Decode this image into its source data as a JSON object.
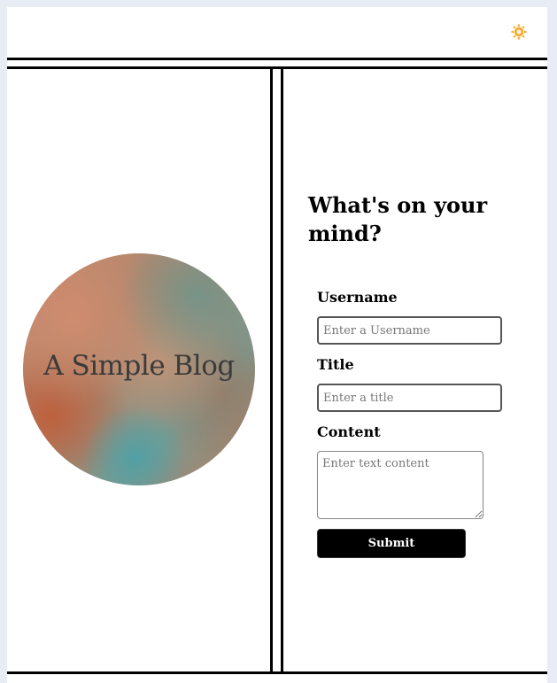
{
  "header": {
    "theme_toggle_icon": "sun-icon",
    "accent_color": "#f5a623"
  },
  "hero": {
    "title": "A Simple Blog"
  },
  "form": {
    "heading": "What's on your mind?",
    "username": {
      "label": "Username",
      "placeholder": "Enter a Username",
      "value": ""
    },
    "title": {
      "label": "Title",
      "placeholder": "Enter a title",
      "value": ""
    },
    "content": {
      "label": "Content",
      "placeholder": "Enter text content",
      "value": ""
    },
    "submit_label": "Submit"
  }
}
